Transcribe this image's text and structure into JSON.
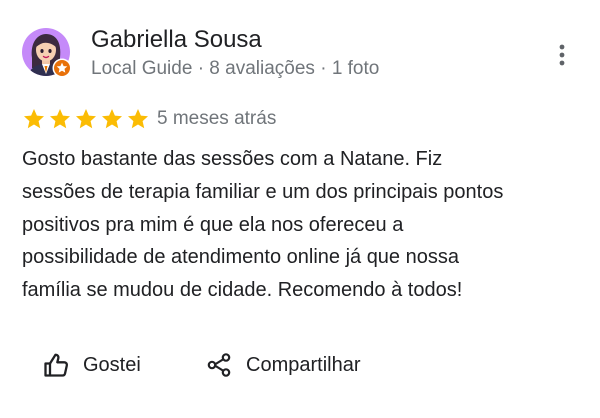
{
  "review": {
    "author": "Gabriella Sousa",
    "meta": {
      "role": "Local Guide",
      "separator": "·",
      "reviews": "8 avaliações",
      "photos": "1 foto"
    },
    "rating": 5,
    "rating_max": 5,
    "date": "5 meses atrás",
    "text_lines": [
      "Gosto bastante das sessões com a Natane. Fiz",
      "sessões de terapia familiar e um dos principais pontos",
      "positivos pra mim é que ela nos ofereceu a",
      "possibilidade de atendimento online já que nossa",
      "família se mudou de cidade. Recomendo à todos!"
    ]
  },
  "actions": {
    "like_label": "Gostei",
    "share_label": "Compartilhar"
  },
  "icons": {
    "avatar": "avatar-illustration",
    "badge": "local-guide-badge-icon",
    "menu": "more-vert-icon",
    "star": "star-icon",
    "like": "thumb-up-icon",
    "share": "share-icon"
  },
  "colors": {
    "star": "#fbbc04",
    "badge": "#e8710a",
    "avatar_bg": "#c58af9",
    "text": "#202124",
    "secondary_text": "#70757a"
  }
}
